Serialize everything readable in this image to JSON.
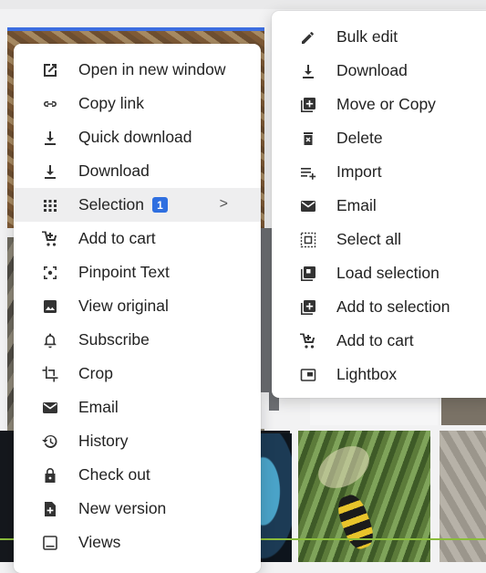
{
  "left_menu": {
    "items": [
      {
        "label": "Open in new window",
        "icon": "open-external-icon"
      },
      {
        "label": "Copy link",
        "icon": "link-icon"
      },
      {
        "label": "Quick download",
        "icon": "download-icon"
      },
      {
        "label": "Download",
        "icon": "download-icon"
      },
      {
        "label": "Selection",
        "icon": "grid-icon",
        "badge": "1",
        "active": true,
        "chevron": ">"
      },
      {
        "label": "Add to cart",
        "icon": "cart-plus-icon"
      },
      {
        "label": "Pinpoint Text",
        "icon": "focus-icon"
      },
      {
        "label": "View original",
        "icon": "image-icon"
      },
      {
        "label": "Subscribe",
        "icon": "bell-icon"
      },
      {
        "label": "Crop",
        "icon": "crop-icon"
      },
      {
        "label": "Email",
        "icon": "mail-icon"
      },
      {
        "label": "History",
        "icon": "history-icon"
      },
      {
        "label": "Check out",
        "icon": "lock-icon"
      },
      {
        "label": "New version",
        "icon": "file-plus-icon"
      },
      {
        "label": "Views",
        "icon": "views-icon"
      }
    ]
  },
  "right_menu": {
    "items": [
      {
        "label": "Bulk edit",
        "icon": "pencil-icon"
      },
      {
        "label": "Download",
        "icon": "download-icon"
      },
      {
        "label": "Move or Copy",
        "icon": "copy-plus-icon"
      },
      {
        "label": "Delete",
        "icon": "trash-icon"
      },
      {
        "label": "Import",
        "icon": "import-list-icon"
      },
      {
        "label": "Email",
        "icon": "mail-icon"
      },
      {
        "label": "Select all",
        "icon": "select-all-icon"
      },
      {
        "label": "Load selection",
        "icon": "load-selection-icon"
      },
      {
        "label": "Add to selection",
        "icon": "copy-plus-icon"
      },
      {
        "label": "Add to cart",
        "icon": "cart-plus-icon"
      },
      {
        "label": "Lightbox",
        "icon": "lightbox-icon"
      }
    ]
  },
  "colors": {
    "accent": "#2f6fe0",
    "highlight_bg": "#eeeeef",
    "menu_bg": "#ffffff"
  }
}
